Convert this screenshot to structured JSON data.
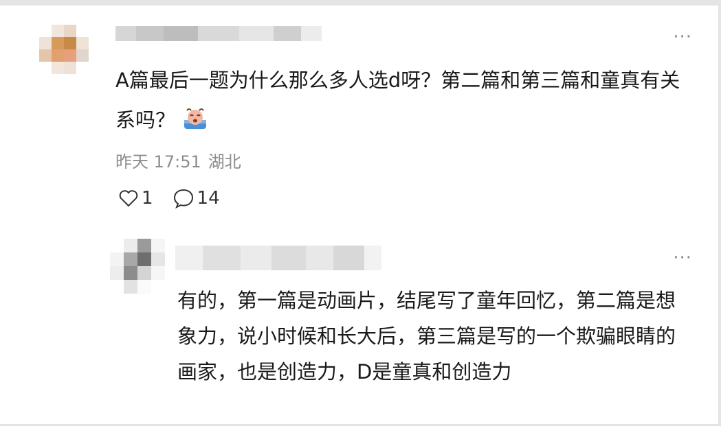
{
  "main_comment": {
    "text": "A篇最后一题为什么那么多人选d呀？第二篇和第三篇和童真有关系吗？",
    "time": "昨天 17:51",
    "location": "湖北",
    "like_count": "1",
    "reply_count": "14",
    "more_label": "···",
    "emoji_icon": "crying-face-icon"
  },
  "reply": {
    "text": "有的，第一篇是动画片，结尾写了童年回忆，第二篇是想象力，说小时候和长大后，第三篇是写的一个欺骗眼睛的画家，也是创造力，D是童真和创造力",
    "more_label": "···"
  },
  "colors": {
    "text": "#1a1a1a",
    "meta": "#8c8c8c",
    "background": "#e4e4e4",
    "card": "#ffffff"
  }
}
